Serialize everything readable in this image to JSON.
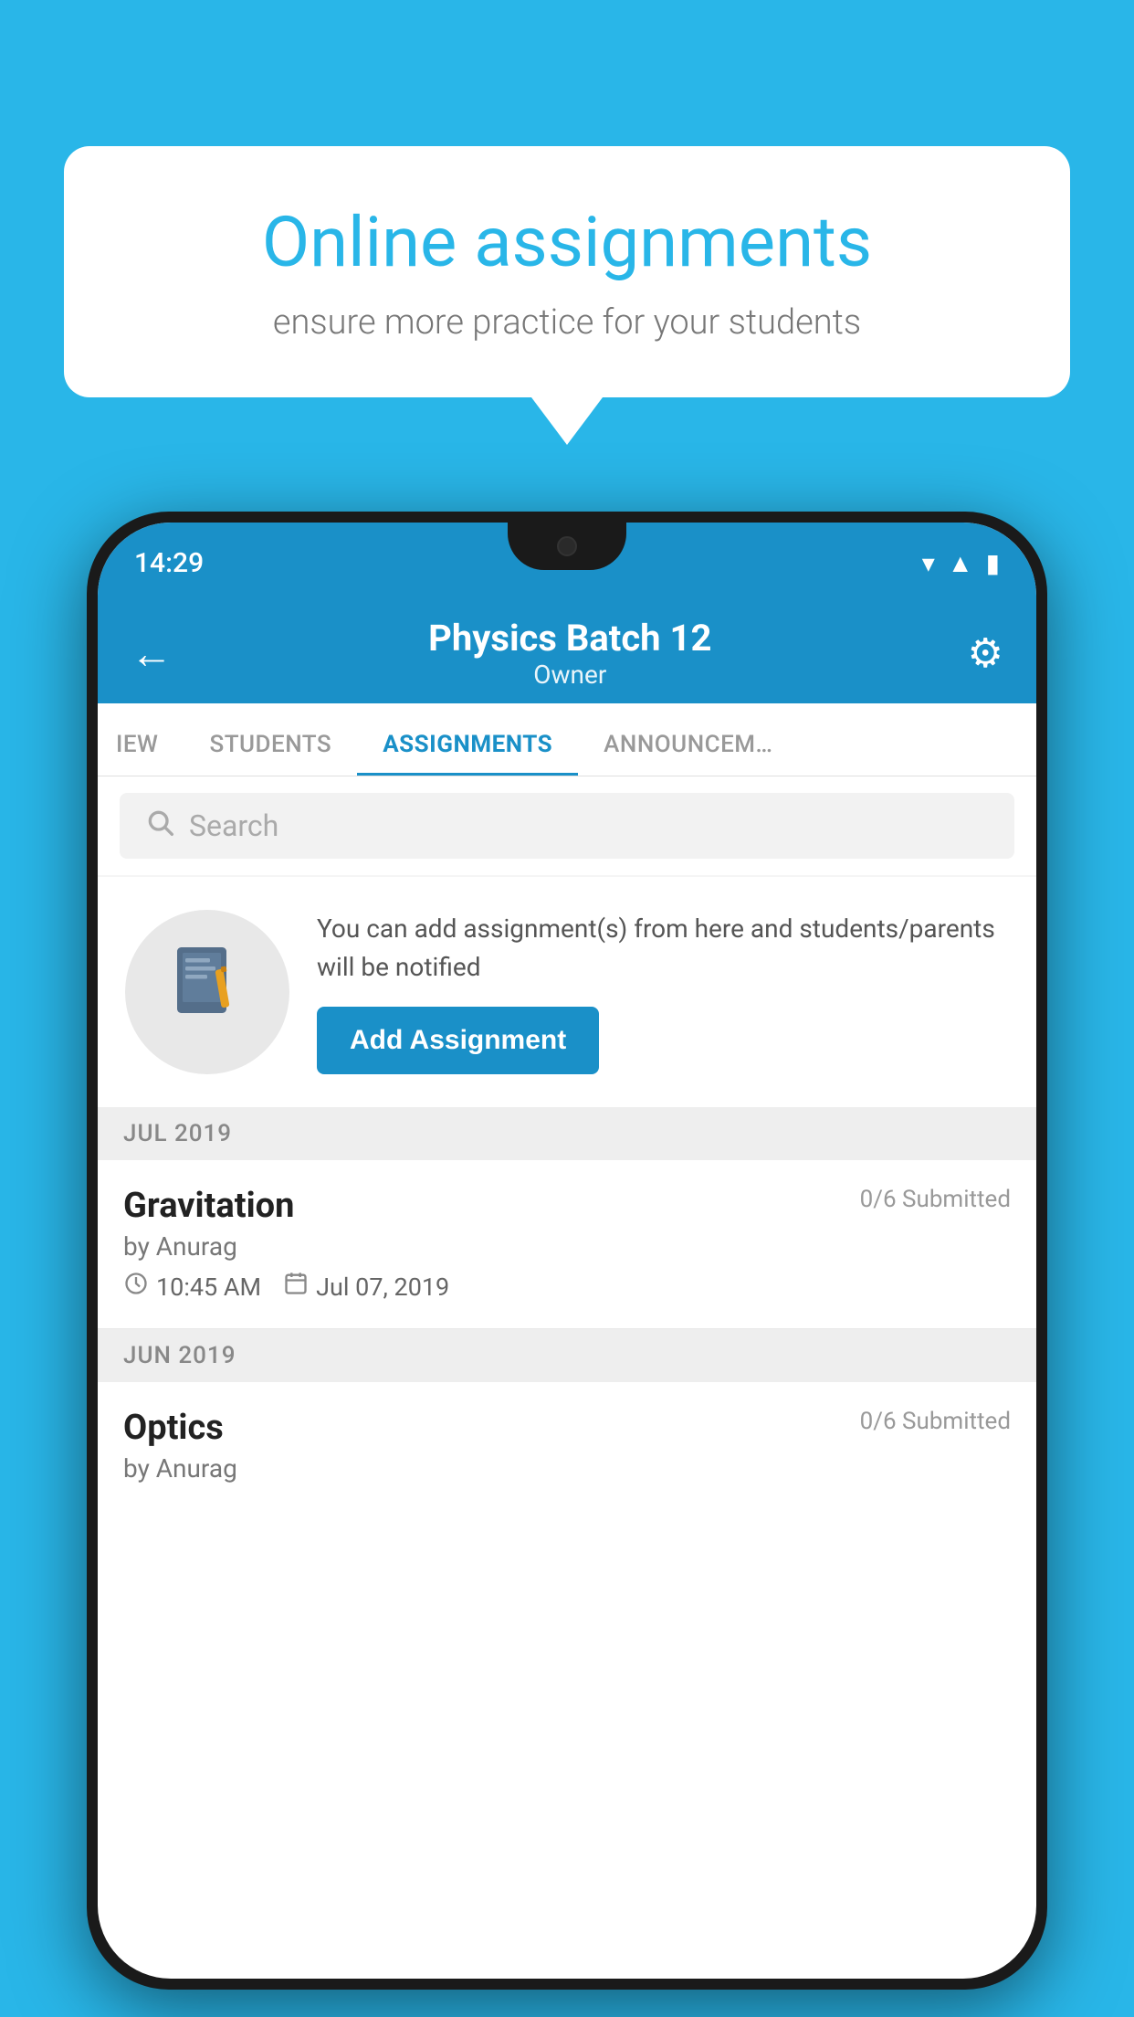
{
  "background_color": "#29b6e8",
  "speech_bubble": {
    "title": "Online assignments",
    "subtitle": "ensure more practice for your students"
  },
  "phone": {
    "status_bar": {
      "time": "14:29",
      "icons": [
        "wifi",
        "signal",
        "battery"
      ]
    },
    "header": {
      "back_label": "←",
      "title": "Physics Batch 12",
      "subtitle": "Owner",
      "settings_label": "⚙"
    },
    "tabs": [
      {
        "label": "IEW",
        "active": false
      },
      {
        "label": "STUDENTS",
        "active": false
      },
      {
        "label": "ASSIGNMENTS",
        "active": true
      },
      {
        "label": "ANNOUNCEM...",
        "active": false
      }
    ],
    "search": {
      "placeholder": "Search"
    },
    "promo": {
      "text": "You can add assignment(s) from here and students/parents will be notified",
      "button_label": "Add Assignment"
    },
    "sections": [
      {
        "header": "JUL 2019",
        "assignments": [
          {
            "name": "Gravitation",
            "submitted": "0/6 Submitted",
            "by": "by Anurag",
            "time": "10:45 AM",
            "date": "Jul 07, 2019"
          }
        ]
      },
      {
        "header": "JUN 2019",
        "assignments": [
          {
            "name": "Optics",
            "submitted": "0/6 Submitted",
            "by": "by Anurag",
            "time": "",
            "date": ""
          }
        ]
      }
    ]
  }
}
